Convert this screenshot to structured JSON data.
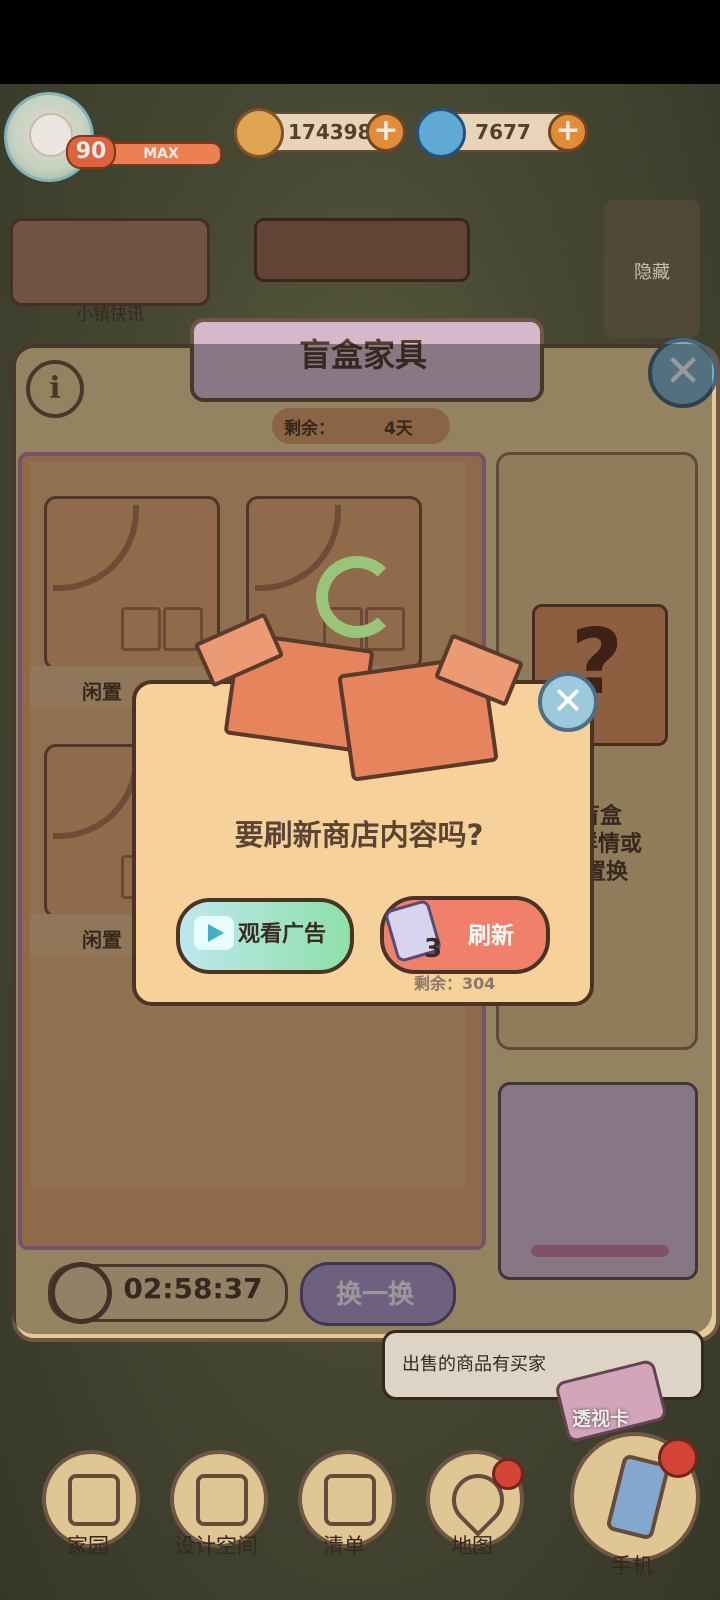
{
  "hud": {
    "level": "90",
    "level_status": "MAX",
    "coins": "174398",
    "gems": "7677",
    "coin_icon": "coin-icon",
    "gem_icon": "swirl-icon"
  },
  "top": {
    "news_label": "小镇快讯",
    "hide_label": "隐藏"
  },
  "panel": {
    "title": "盲盒家具",
    "remain_label": "剩余：",
    "remain_value": "4天",
    "slots": [
      {
        "label": "闲置"
      },
      {
        "label": "闲置"
      }
    ],
    "side_text": [
      "盲盒",
      "详情或",
      "置换"
    ],
    "timer": "02:58:37",
    "swap_label": "换一换"
  },
  "notice": {
    "text": "出售的商品有买家",
    "xray_label": "透视卡"
  },
  "nav": [
    {
      "label": "家园",
      "icon": "home-icon"
    },
    {
      "label": "设计空间",
      "icon": "design-icon"
    },
    {
      "label": "清单",
      "icon": "checklist-icon"
    },
    {
      "label": "地图",
      "icon": "map-pin-icon"
    },
    {
      "label": "手机",
      "icon": "phone-icon"
    }
  ],
  "dialog": {
    "question": "要刷新商店内容吗?",
    "watch_ad": "观看广告",
    "refresh": "刷新",
    "refresh_cost": "3",
    "remaining": "剩余：304"
  },
  "colors": {
    "panel_bg": "#f7dca4",
    "refresh_btn": "#f0806a",
    "ad_btn": "#8ee0a8",
    "accent_red": "#e54a3a"
  }
}
